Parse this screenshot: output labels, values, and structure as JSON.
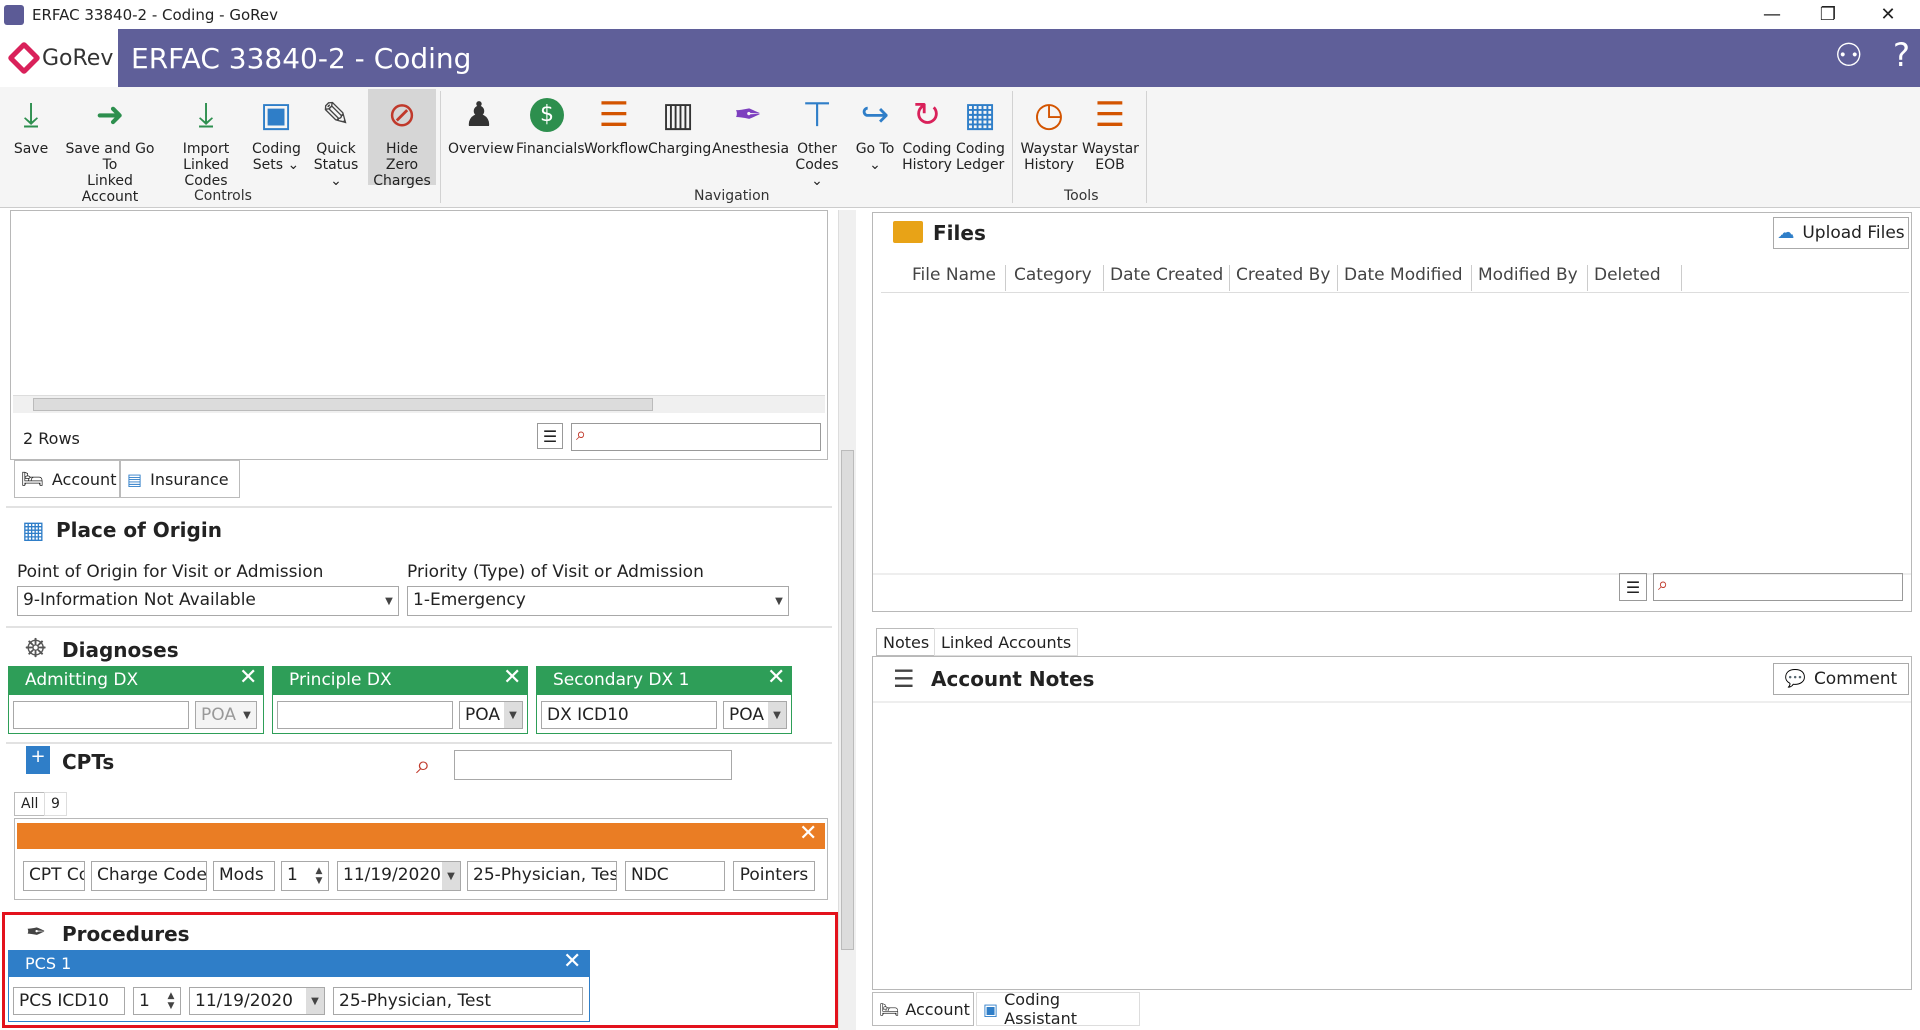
{
  "window": {
    "title": "ERFAC 33840-2 - Coding - GoRev",
    "minimize": "—",
    "restore": "❐",
    "close": "✕"
  },
  "header": {
    "logo_text": "GoRev",
    "title": "ERFAC 33840-2 - Coding",
    "help": "?"
  },
  "ribbon": {
    "save": "Save",
    "save_go_1": "Save and Go To",
    "save_go_2": "Linked Account",
    "import_1": "Import",
    "import_2": "Linked Codes",
    "coding_sets_1": "Coding",
    "coding_sets_2": "Sets ⌄",
    "quick_status_1": "Quick",
    "quick_status_2": "Status ⌄",
    "hide_zero_1": "Hide Zero",
    "hide_zero_2": "Charges",
    "overview": "Overview",
    "financials": "Financials",
    "workflow": "Workflow",
    "charging": "Charging",
    "anesthesia": "Anesthesia",
    "other_codes_1": "Other",
    "other_codes_2": "Codes ⌄",
    "go_to_1": "Go To",
    "go_to_2": "⌄",
    "coding_history_1": "Coding",
    "coding_history_2": "History",
    "coding_ledger_1": "Coding",
    "coding_ledger_2": "Ledger",
    "waystar_history_1": "Waystar",
    "waystar_history_2": "History",
    "waystar_eob_1": "Waystar",
    "waystar_eob_2": "EOB",
    "group_controls": "Controls",
    "group_navigation": "Navigation",
    "group_tools": "Tools"
  },
  "left": {
    "rows_label": "2 Rows",
    "tab_account": "Account",
    "tab_insurance": "Insurance",
    "place_of_origin": "Place of Origin",
    "point_of_origin_label": "Point of Origin for Visit or Admission",
    "point_of_origin_value": "9-Information Not Available",
    "priority_label": "Priority (Type) of Visit or Admission",
    "priority_value": "1-Emergency",
    "diagnoses": "Diagnoses",
    "admitting_dx": "Admitting DX",
    "principle_dx": "Principle DX",
    "secondary_dx": "Secondary DX 1",
    "poa": "POA",
    "dx_icd10": "DX ICD10",
    "cpts": "CPTs",
    "cpt_tab_all": "All",
    "cpt_tab_9": "9",
    "cpt_code": "CPT Co",
    "charge_code": "Charge Code",
    "mods": "Mods",
    "qty": "1",
    "date": "11/19/2020",
    "physician": "25-Physician, Test",
    "ndc": "NDC",
    "pointers": "Pointers",
    "procedures": "Procedures",
    "pcs1": "PCS 1",
    "pcs_icd10": "PCS ICD10"
  },
  "right": {
    "files": "Files",
    "upload_files": "Upload Files",
    "columns": [
      "File Name",
      "Category",
      "Date Created",
      "Created By",
      "Date Modified",
      "Modified By",
      "Deleted"
    ],
    "tab_notes": "Notes",
    "tab_linked_accounts": "Linked Accounts",
    "account_notes": "Account Notes",
    "comment": "Comment",
    "bottom_tab_account": "Account",
    "bottom_tab_coding_assistant": "Coding Assistant"
  },
  "colors": {
    "header": "#5f5f99",
    "green": "#2e9e58",
    "orange": "#ea7d24",
    "blue": "#2f7ec8",
    "highlight": "#e3121c"
  }
}
